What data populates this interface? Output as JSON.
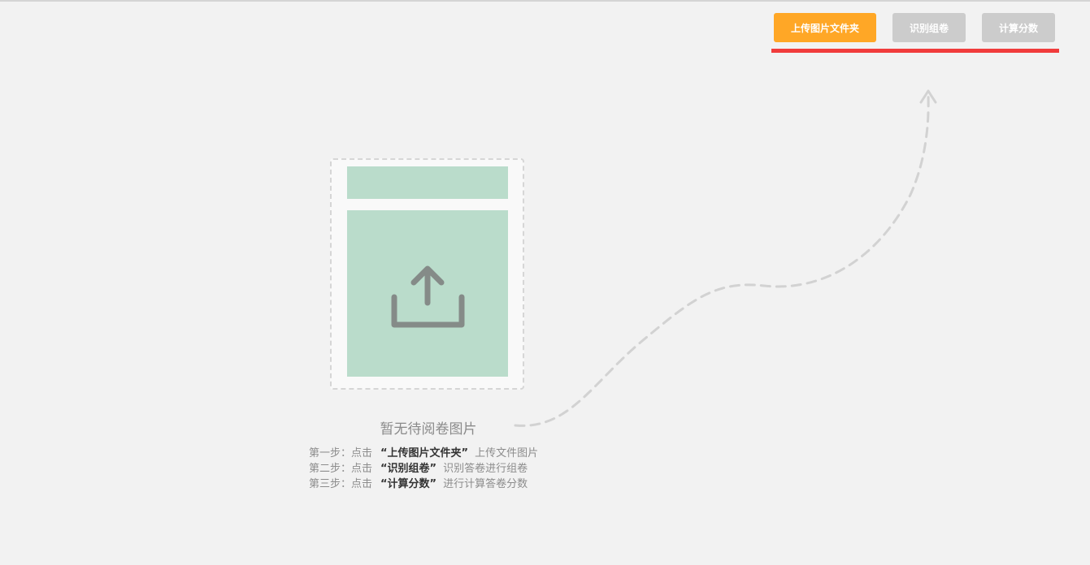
{
  "toolbar": {
    "upload_label": "上传图片文件夹",
    "recognize_label": "识别组卷",
    "score_label": "计算分数"
  },
  "colors": {
    "background": "#f2f2f2",
    "upload_button": "#ffa726",
    "disabled_button": "#cccccc",
    "highlight_underline": "#f13c3c",
    "illustration_fill": "#badccb",
    "icon": "#858b88"
  },
  "empty_state": {
    "title": "暂无待阅卷图片",
    "icon": "upload-icon",
    "steps": [
      {
        "prefix": "第一步：点击",
        "action": "“上传图片文件夹”",
        "suffix": "上传文件图片"
      },
      {
        "prefix": "第二步：点击",
        "action": "“识别组卷”",
        "suffix": "识别答卷进行组卷"
      },
      {
        "prefix": "第三步：点击",
        "action": "“计算分数”",
        "suffix": "进行计算答卷分数"
      }
    ]
  }
}
